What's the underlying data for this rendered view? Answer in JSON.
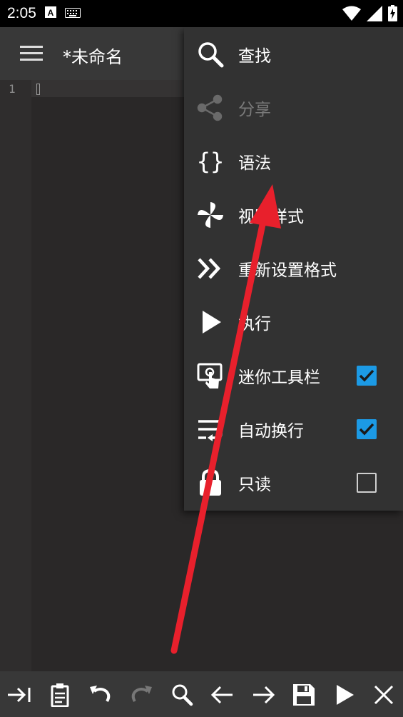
{
  "status_bar": {
    "time": "2:05"
  },
  "appbar": {
    "title": "*未命名"
  },
  "editor": {
    "line_numbers": [
      "1"
    ]
  },
  "menu": {
    "items": [
      {
        "label": "查找",
        "icon": "search-icon",
        "enabled": true
      },
      {
        "label": "分享",
        "icon": "share-icon",
        "enabled": false
      },
      {
        "label": "语法",
        "icon": "braces-icon",
        "enabled": true
      },
      {
        "label": "视图样式",
        "icon": "pinwheel-icon",
        "enabled": true
      },
      {
        "label": "重新设置格式",
        "icon": "double-chevron-icon",
        "enabled": true
      },
      {
        "label": "执行",
        "icon": "play-icon",
        "enabled": true
      },
      {
        "label": "迷你工具栏",
        "icon": "touch-icon",
        "enabled": true,
        "checked": true
      },
      {
        "label": "自动换行",
        "icon": "wrap-text-icon",
        "enabled": true,
        "checked": true
      },
      {
        "label": "只读",
        "icon": "lock-icon",
        "enabled": true,
        "checked": false
      }
    ]
  },
  "toolbar": {
    "buttons": [
      "tab-icon",
      "paste-icon",
      "undo-icon",
      "redo-icon",
      "search-icon",
      "arrow-left-icon",
      "arrow-right-icon",
      "save-icon",
      "run-icon",
      "close-icon"
    ]
  },
  "colors": {
    "appbar": "#383838",
    "menu": "#323232",
    "checkbox_checked": "#1c9ae5",
    "annotation_arrow": "#e8202c"
  }
}
